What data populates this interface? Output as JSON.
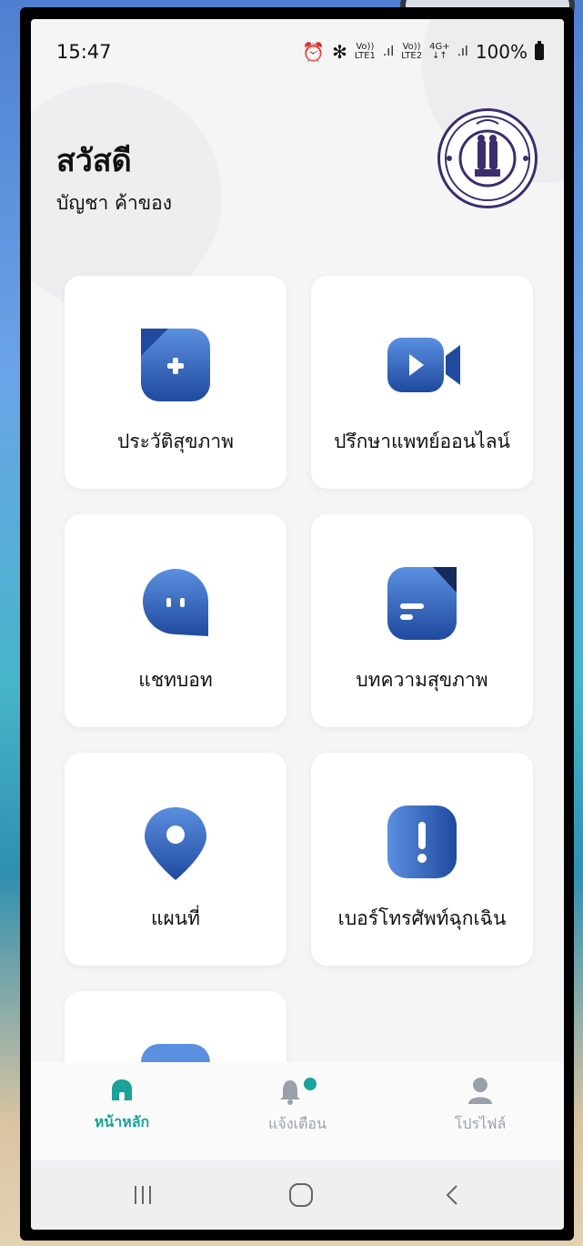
{
  "status_bar": {
    "time": "15:47",
    "net1_top": "Vo))",
    "net1_bottom": "LTE1",
    "net2_top": "Vo))",
    "net2_bottom": "LTE2",
    "net3_top": "4G+",
    "net3_bottom": "↓↑",
    "battery": "100%"
  },
  "header": {
    "greeting": "สวัสดี",
    "user_name": "บัญชา ค้าของ"
  },
  "menu": [
    {
      "label": "ประวัติสุขภาพ",
      "icon": "medical-history-icon"
    },
    {
      "label": "ปรึกษาแพทย์ออนไลน์",
      "icon": "video-call-icon"
    },
    {
      "label": "แชทบอท",
      "icon": "chatbot-icon"
    },
    {
      "label": "บทความสุขภาพ",
      "icon": "article-icon"
    },
    {
      "label": "แผนที่",
      "icon": "map-pin-icon"
    },
    {
      "label": "เบอร์โทรศัพท์ฉุกเฉิน",
      "icon": "emergency-icon"
    }
  ],
  "bottom_nav": {
    "home": "หน้าหลัก",
    "notifications": "แจ้งเตือน",
    "profile": "โปรไฟล์"
  },
  "colors": {
    "accent": "#1aa39a",
    "icon_dark": "#1f4a9e",
    "icon_light": "#5b8fe0",
    "inactive": "#9aa0a8"
  }
}
